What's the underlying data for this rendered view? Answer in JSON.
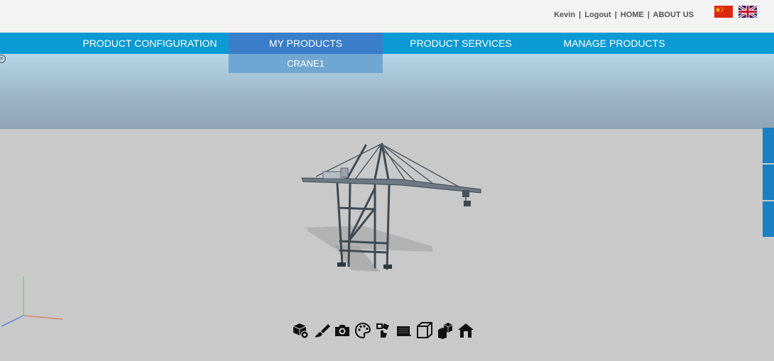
{
  "header": {
    "links": [
      {
        "label": "Kevin"
      },
      {
        "label": "Logout"
      },
      {
        "label": "HOME"
      },
      {
        "label": "ABOUT US"
      }
    ],
    "flags": [
      "china-flag-icon",
      "uk-flag-icon"
    ]
  },
  "nav": {
    "items": [
      {
        "label": "PRODUCT CONFIGURATION"
      },
      {
        "label": "MY PRODUCTS"
      },
      {
        "label": "PRODUCT SERVICES"
      },
      {
        "label": "MANAGE PRODUCTS"
      }
    ],
    "active_index": 1,
    "dropdown": {
      "items": [
        {
          "label": "CRANE1"
        }
      ]
    }
  },
  "toolbar": {
    "tools": [
      "cube-view-icon",
      "brush-icon",
      "camera-icon",
      "palette-icon",
      "touch-rotate-icon",
      "keyboard-icon",
      "cube-wireframe-icon",
      "explode-icon",
      "home-icon"
    ]
  },
  "colors": {
    "nav_bg": "#0b9ad3",
    "nav_active": "#3a7ec9",
    "dropdown_bg": "#6fa6d2",
    "viewport_bg": "#c9c9c9",
    "side_tab": "#1b7fc4"
  }
}
